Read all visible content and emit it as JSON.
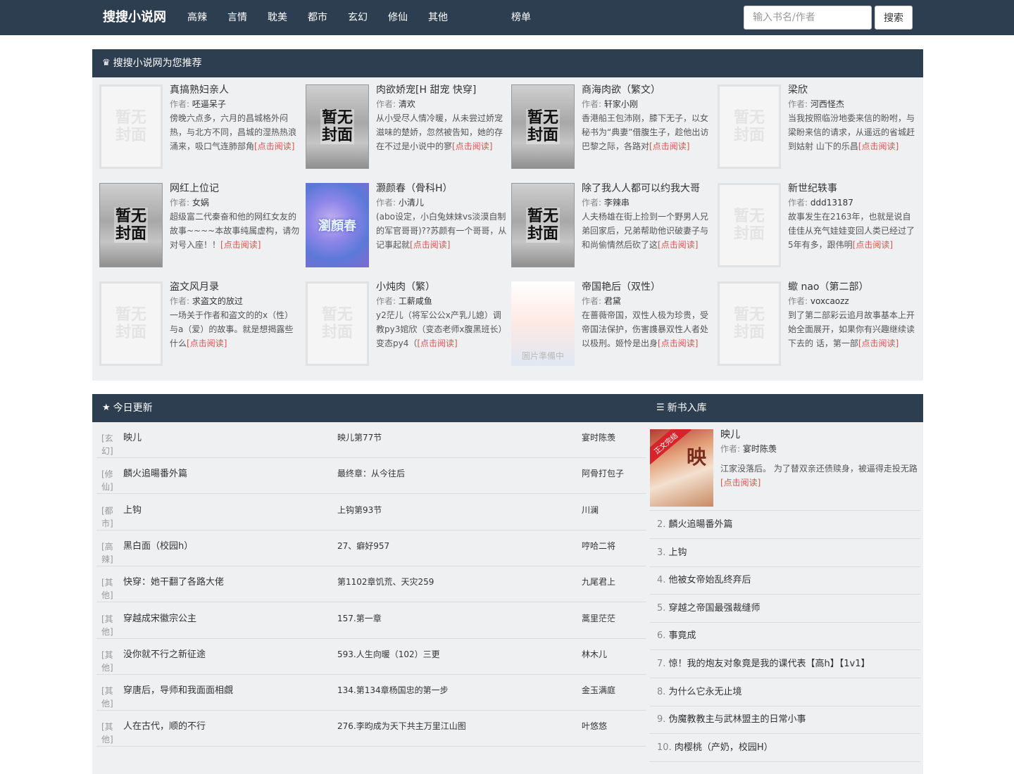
{
  "header": {
    "brand": "搜搜小说网",
    "nav": [
      "高辣",
      "言情",
      "耽美",
      "都市",
      "玄幻",
      "修仙",
      "其他"
    ],
    "rank": "榜单",
    "search_placeholder": "输入书名/作者",
    "search_button": "搜索"
  },
  "recommend": {
    "title": "搜搜小说网为您推荐",
    "author_label": "作者:",
    "more": "[点击阅读]",
    "cover_none_text": "暂无封面",
    "cover_blue_text": "瀏顏春",
    "cover_girl_text": "圖片準備中",
    "books": [
      {
        "title": "真搞熟妇亲人",
        "author": "呸逼呆子",
        "desc": "傍晚六点多，六月的昌城格外闷热，与北方不同，昌城的湿热热浪涌来，吸口气连肺部角",
        "cover": "none"
      },
      {
        "title": "肉欲娇宠[H 甜宠 快穿]",
        "author": "清欢",
        "desc": "从小受尽人情冷暖，从未尝过娇宠滋味的楚娇，忽然被告知，她的存在不过是小说中的寥",
        "cover": "pav"
      },
      {
        "title": "商海肉欲（繁文）",
        "author": "轩家小刚",
        "desc": "香港船王包沛刚，膝下无子，以女秘书为“典妻”借腹生子，趁他出访巴黎之际，各路对",
        "cover": "pav"
      },
      {
        "title": "梁欣",
        "author": "河西怪杰",
        "desc": "当我按照临汾地委来信的盼咐，与梁盼来信的请求，从遥远的省城赶到姑射 山下的乐昌",
        "cover": "none"
      },
      {
        "title": "网红上位记",
        "author": "女娲",
        "desc": "超级富二代秦奋和他的网红女友的故事~~~~本故事纯属虚构，请勿对号入座！！",
        "cover": "pav"
      },
      {
        "title": "灏颜春（骨科H）",
        "author": "小清儿",
        "desc": "(abo设定，小白兔妹妹vs淡漠自制的军官哥哥)??苏颜有一个哥哥，从记事起就",
        "cover": "blue"
      },
      {
        "title": "除了我人人都可以约我大哥",
        "author": "李辣串",
        "desc": "人夫杨雄在街上捡到一个野男人兄弟回家后，兄弟帮助他识破妻子与和尚偷情然后砍了这",
        "cover": "pav"
      },
      {
        "title": "新世纪轶事",
        "author": "ddd13187",
        "desc": "故事发生在2163年，也就是说自佳佳从充气娃娃变回人类已经过了5年有多，跟伟明",
        "cover": "none"
      },
      {
        "title": "盗文风月录",
        "author": "求盗文的放过",
        "desc": "一场关于作者和盗文的的x（性）与a（爱）的故事。就是想揭露些什么",
        "cover": "none"
      },
      {
        "title": "小炖肉（繁）",
        "author": "工薪咸鱼",
        "desc": "y2茫儿（将军公公x产乳儿媳）调教py3婠欣（变态老师x腹黑班长）变态py4（",
        "cover": "none"
      },
      {
        "title": "帝国艳后（双性）",
        "author": "君黛",
        "desc": "在蔷薇帝国，双性人极为珍贵，受帝国法保护，伤害謢暴双性人者处以极刑。姬怜是出身",
        "cover": "girl"
      },
      {
        "title": "蠍 nao（第二部）",
        "author": "voxcaozz",
        "desc": "到了第二部彩云追月故事基本上开始全面展开，如果你有兴趣继续读下去的 话，第一部",
        "cover": "none"
      }
    ]
  },
  "today": {
    "title": "今日更新",
    "rows": [
      {
        "cat": "[玄幻]",
        "name": "映儿",
        "chapter": "映儿第77节",
        "author": "宴时陈羡"
      },
      {
        "cat": "[修仙]",
        "name": "麟火追暘番外篇",
        "chapter": "最终章：从今往后",
        "author": "阿骨打包子"
      },
      {
        "cat": "[都市]",
        "name": "上钩",
        "chapter": "上钩第93节",
        "author": "川澜"
      },
      {
        "cat": "[高辣]",
        "name": "黑白面（校园h）",
        "chapter": "27、癖好957",
        "author": "哼哈二将"
      },
      {
        "cat": "[其他]",
        "name": "快穿：她干翻了各路大佬",
        "chapter": "第1102章饥荒、天灾259",
        "author": "九尾君上"
      },
      {
        "cat": "[其他]",
        "name": "穿越成宋徽宗公主",
        "chapter": "157.第一章",
        "author": "蒿里茫茫"
      },
      {
        "cat": "[其他]",
        "name": "没你就不行之新征途",
        "chapter": "593.人生向暖（102）三更",
        "author": "林木儿"
      },
      {
        "cat": "[其他]",
        "name": "穿唐后，导师和我面面相覷",
        "chapter": "134.第134章杨国忠的第一步",
        "author": "金玉满庭"
      },
      {
        "cat": "[其他]",
        "name": "人在古代，顺的不行",
        "chapter": "276.李昀成为天下共主万里江山图",
        "author": "叶悠悠"
      }
    ]
  },
  "newbooks": {
    "title": "新书入库",
    "author_label": "作者:",
    "more": "[点击阅读]",
    "first": {
      "title": "映儿",
      "author": "宴时陈羡",
      "desc": "江家没落后。 为了替双亲还债赎身，被逼得走投无路",
      "cover_tag": "正文完结",
      "cover_text": "映"
    },
    "items": [
      {
        "num": "2.",
        "title": "麟火追暘番外篇"
      },
      {
        "num": "3.",
        "title": "上钩"
      },
      {
        "num": "4.",
        "title": "他被女帝始乱终弃后"
      },
      {
        "num": "5.",
        "title": "穿越之帝国最强裁缝师"
      },
      {
        "num": "6.",
        "title": "事竟成"
      },
      {
        "num": "7.",
        "title": "惊！我的炮友对象竟是我的课代表【高h】【1v1】"
      },
      {
        "num": "8.",
        "title": "为什么它永无止境"
      },
      {
        "num": "9.",
        "title": "伪魔教教主与武林盟主的日常小事"
      },
      {
        "num": "10.",
        "title": "肉樱桃（产奶，校园H）"
      }
    ]
  }
}
